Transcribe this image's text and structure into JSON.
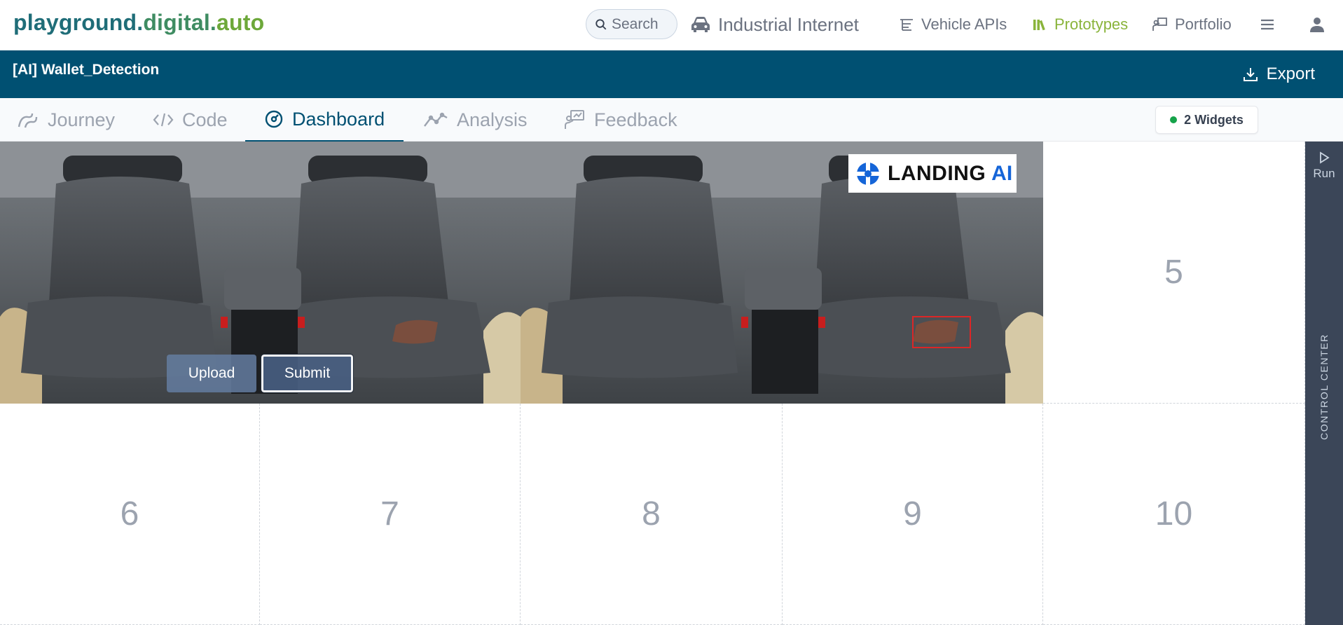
{
  "logo": {
    "part1": "playground.",
    "part2": "digital.",
    "part3": "auto"
  },
  "nav": {
    "search_placeholder": "Search",
    "items": [
      {
        "label": "Industrial Internet",
        "icon": "car-icon"
      },
      {
        "label": "Vehicle APIs",
        "icon": "tree-list-icon"
      },
      {
        "label": "Prototypes",
        "icon": "library-icon",
        "active_color": "#8ab43b"
      },
      {
        "label": "Portfolio",
        "icon": "presentation-icon"
      }
    ],
    "menu_icon": "hamburger-icon",
    "user_icon": "user-icon"
  },
  "header": {
    "title": "[AI] Wallet_Detection",
    "export_label": "Export",
    "bar_color": "#005072"
  },
  "tabs": [
    {
      "label": "Journey",
      "icon": "journey-icon"
    },
    {
      "label": "Code",
      "icon": "code-icon"
    },
    {
      "label": "Dashboard",
      "icon": "gauge-icon",
      "active": true
    },
    {
      "label": "Analysis",
      "icon": "chart-line-icon"
    },
    {
      "label": "Feedback",
      "icon": "feedback-icon"
    }
  ],
  "widgets_badge": "2 Widgets",
  "dashboard": {
    "widget1": {
      "upload_label": "Upload",
      "submit_label": "Submit"
    },
    "widget2": {
      "brand_text": "LANDING",
      "brand_accent": "AI"
    },
    "empty_cells": [
      "5",
      "6",
      "7",
      "8",
      "9",
      "10"
    ]
  },
  "control_center": {
    "run_label": "Run",
    "label": "CONTROL CENTER"
  }
}
